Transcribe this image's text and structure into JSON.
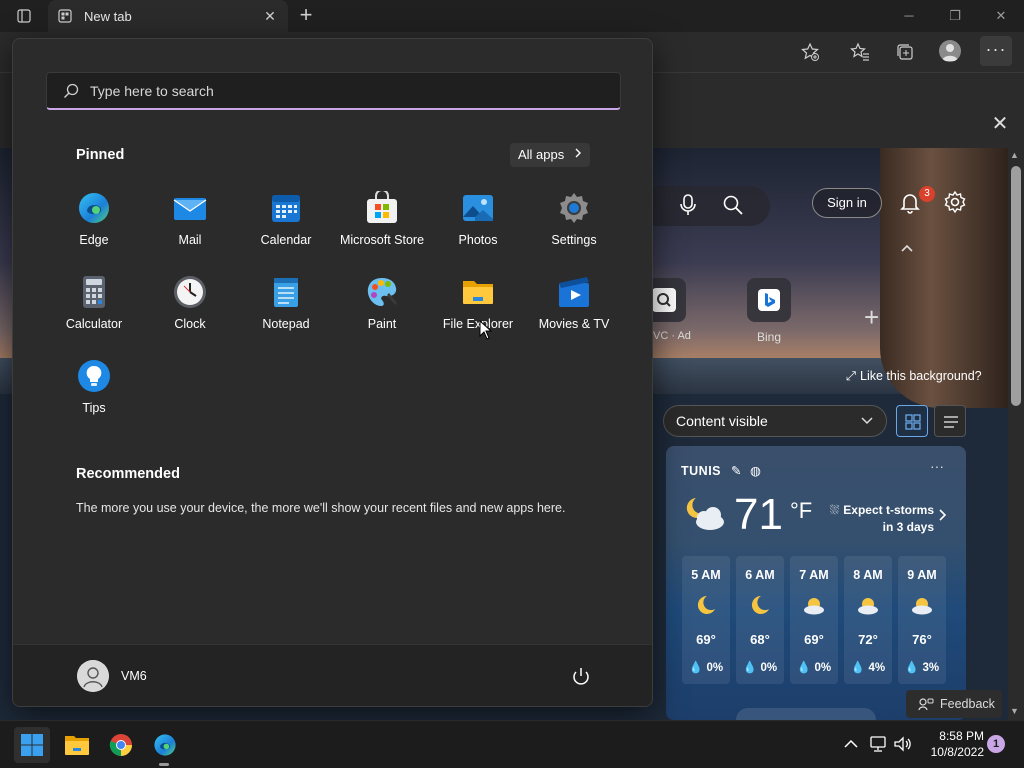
{
  "browser": {
    "tab_title": "New tab",
    "window_controls": [
      "minimize",
      "restore",
      "close"
    ]
  },
  "ntp": {
    "signin_label": "Sign in",
    "notification_count": "3",
    "quick_links": [
      {
        "label": "VC · Ad"
      },
      {
        "label": "Bing"
      }
    ],
    "like_background": "Like this background?",
    "content_select": "Content visible",
    "feedback": "Feedback",
    "weather": {
      "city": "TUNIS",
      "temp": "71",
      "unit": "°F",
      "alert_line1": "Expect t-storms",
      "alert_line2": "in 3 days",
      "hourly": [
        {
          "time": "5 AM",
          "icon": "moon-icon",
          "temp": "69°",
          "precip": "0%"
        },
        {
          "time": "6 AM",
          "icon": "moon-icon",
          "temp": "68°",
          "precip": "0%"
        },
        {
          "time": "7 AM",
          "icon": "partly-cloudy-icon",
          "temp": "69°",
          "precip": "0%"
        },
        {
          "time": "8 AM",
          "icon": "partly-cloudy-icon",
          "temp": "72°",
          "precip": "4%"
        },
        {
          "time": "9 AM",
          "icon": "partly-cloudy-icon",
          "temp": "76°",
          "precip": "3%"
        }
      ]
    }
  },
  "start_menu": {
    "search_placeholder": "Type here to search",
    "pinned_title": "Pinned",
    "all_apps_label": "All apps",
    "pinned_apps": [
      {
        "label": "Edge",
        "icon": "edge-icon"
      },
      {
        "label": "Mail",
        "icon": "mail-icon"
      },
      {
        "label": "Calendar",
        "icon": "calendar-icon"
      },
      {
        "label": "Microsoft Store",
        "icon": "store-icon"
      },
      {
        "label": "Photos",
        "icon": "photos-icon"
      },
      {
        "label": "Settings",
        "icon": "settings-icon"
      },
      {
        "label": "Calculator",
        "icon": "calculator-icon"
      },
      {
        "label": "Clock",
        "icon": "clock-icon"
      },
      {
        "label": "Notepad",
        "icon": "notepad-icon"
      },
      {
        "label": "Paint",
        "icon": "paint-icon"
      },
      {
        "label": "File Explorer",
        "icon": "folder-icon"
      },
      {
        "label": "Movies & TV",
        "icon": "movies-icon"
      },
      {
        "label": "Tips",
        "icon": "tips-icon"
      }
    ],
    "recommended_title": "Recommended",
    "recommended_text": "The more you use your device, the more we'll show your recent files and new apps here.",
    "user_name": "VM6"
  },
  "taskbar": {
    "apps": [
      "start-icon",
      "file-explorer-icon",
      "chrome-icon",
      "edge-icon"
    ],
    "time": "8:58 PM",
    "date": "10/8/2022",
    "notification_count": "1"
  },
  "colors": {
    "accent": "#c9a7e6",
    "start_bg": "#2b2b2b",
    "taskbar_bg": "#1c1c1c"
  }
}
